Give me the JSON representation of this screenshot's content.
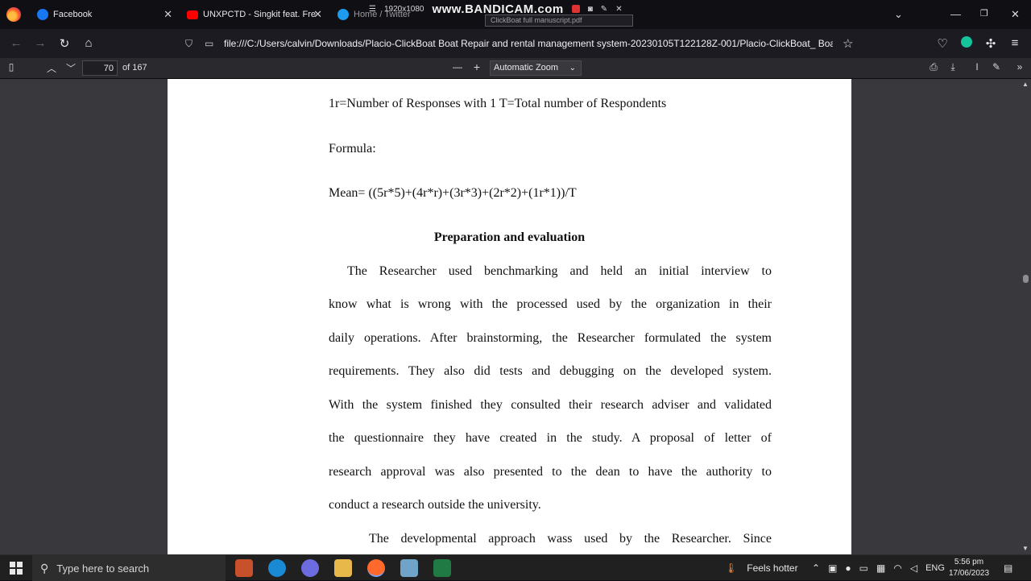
{
  "tabs": [
    {
      "label": "Facebook",
      "icon": "facebook-icon",
      "color": "#1877f2"
    },
    {
      "label": "UNXPCTD - Singkit feat. FreshB",
      "icon": "youtube-icon",
      "color": "#ff0000"
    },
    {
      "label": "Home / Twitter",
      "icon": "twitter-icon",
      "color": "#1d9bf0"
    }
  ],
  "recorder": {
    "resolution": "1920x1080",
    "brand": "www.BANDICAM.com",
    "tooltip": "ClickBoat full manuscript.pdf"
  },
  "url": "file:///C:/Users/calvin/Downloads/Placio-ClickBoat Boat Repair and rental management system-20230105T122128Z-001/Placio-ClickBoat_ Boat Repair",
  "pdf_toolbar": {
    "page_number": "70",
    "page_total": "of 167",
    "zoom": "Automatic Zoom"
  },
  "document": {
    "legend_line": "1r=Number of Responses with 1    T=Total number of Respondents",
    "formula_label": "Formula:",
    "formula": "Mean= ((5r*5)+(4r*r)+(3r*3)+(2r*2)+(1r*1))/T",
    "heading": "Preparation and evaluation",
    "paragraph_lines": [
      "The Researcher used benchmarking and held an initial interview to",
      "know what is wrong with the processed used by the organization in their",
      "daily operations. After brainstorming, the Researcher formulated the system",
      "requirements. They also did tests and debugging on the developed system.",
      "With the system finished they consulted their research adviser and validated",
      "the questionnaire they have created in the study. A proposal of letter of",
      "research approval was also presented to the dean to have the authority to",
      "conduct a research outside the university."
    ],
    "next_paragraph_start": "The developmental approach wass used by the Researcher. Since"
  },
  "taskbar": {
    "search_placeholder": "Type here to search",
    "weather": "Feels hotter",
    "language": "ENG",
    "time": "5:56 pm",
    "date": "17/06/2023"
  }
}
